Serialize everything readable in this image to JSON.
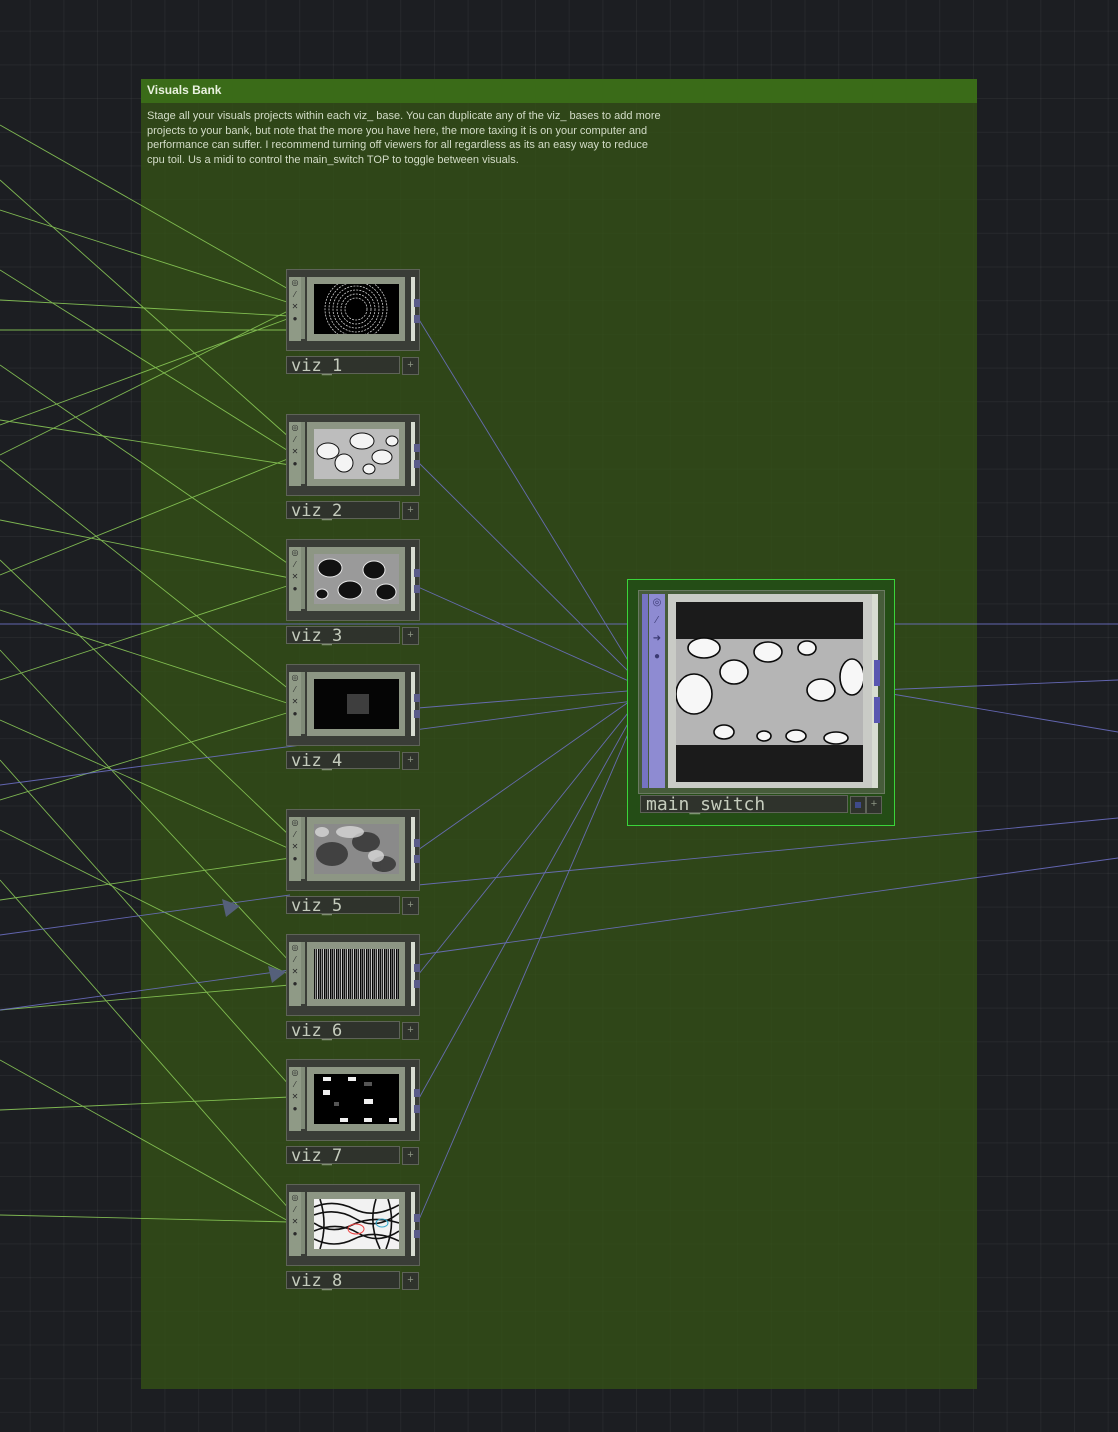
{
  "annotation": {
    "title": "Visuals Bank",
    "body": "Stage all your visuals projects within each viz_ base. You can duplicate any of the viz_ bases to add more projects to your bank, but note that the more you have here, the more taxing it is on your computer and performance can suffer. I recommend turning off viewers for all regardless as its an easy way to reduce cpu toil. Us a midi to control the main_switch TOP to toggle between visuals."
  },
  "nodes": [
    {
      "name": "viz_1",
      "thumb": "rings-pattern"
    },
    {
      "name": "viz_2",
      "thumb": "white-blobs"
    },
    {
      "name": "viz_3",
      "thumb": "dark-blobs"
    },
    {
      "name": "viz_4",
      "thumb": "dim-square"
    },
    {
      "name": "viz_5",
      "thumb": "grey-smoke"
    },
    {
      "name": "viz_6",
      "thumb": "vertical-noise"
    },
    {
      "name": "viz_7",
      "thumb": "white-rectangles"
    },
    {
      "name": "viz_8",
      "thumb": "rainbow-zebra"
    }
  ],
  "main_switch": {
    "name": "main_switch",
    "thumb": "white-blobs-letterbox"
  },
  "flag_icons": [
    "bypass-icon",
    "lock-icon",
    "cross-icon",
    "viewer-icon"
  ],
  "plus_label": "+",
  "colors": {
    "background": "#1c1e22",
    "annotation_fill": "#34521a",
    "annotation_header": "#3a6b18",
    "selected_outline": "#3ad43a",
    "chop_wire": "#8fd15a",
    "top_wire": "#6f72c9"
  }
}
